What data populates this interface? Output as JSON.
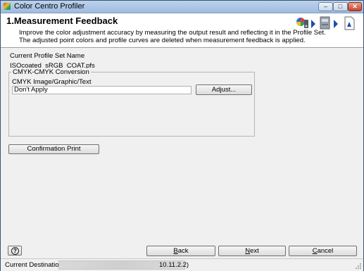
{
  "window": {
    "title": "Color Centro Profiler",
    "controls": {
      "minimize": "–",
      "maximize": "□",
      "close": "✕"
    }
  },
  "header": {
    "title": "1.Measurement Feedback",
    "description_line1": "Improve the color adjustment accuracy by measuring the output result and reflecting it in the Profile Set.",
    "description_line2": "The adjusted point colors and profile curves are deleted when measurement feedback is applied.",
    "step_icons": [
      "color-wheel-icon",
      "arrow-right-icon",
      "printer-icon",
      "arrow-right-icon",
      "document-icon"
    ]
  },
  "profile": {
    "label": "Current Profile Set Name",
    "value": "ISOcoated_sRGB_COAT.pfs"
  },
  "conversion": {
    "group_title": "CMYK-CMYK Conversion",
    "field_label": "CMYK Image/Graphic/Text",
    "field_value": "Don't Apply",
    "adjust_button": "Adjust..."
  },
  "confirmation_button": "Confirmation Print",
  "footer": {
    "help_icon": "?",
    "back_button": {
      "prefix": "",
      "mnemonic": "B",
      "rest": "ack"
    },
    "next_button": {
      "prefix": "",
      "mnemonic": "N",
      "rest": "ext"
    },
    "cancel_button": {
      "prefix": "",
      "mnemonic": "C",
      "rest": "ancel"
    }
  },
  "status": {
    "label": "Current Destination",
    "value": "10.11.2.2)"
  },
  "colors": {
    "accent_arrow": "#1e4da8",
    "title_bar": "#bcd3ee",
    "dialog_bg": "#f0f0f0"
  }
}
